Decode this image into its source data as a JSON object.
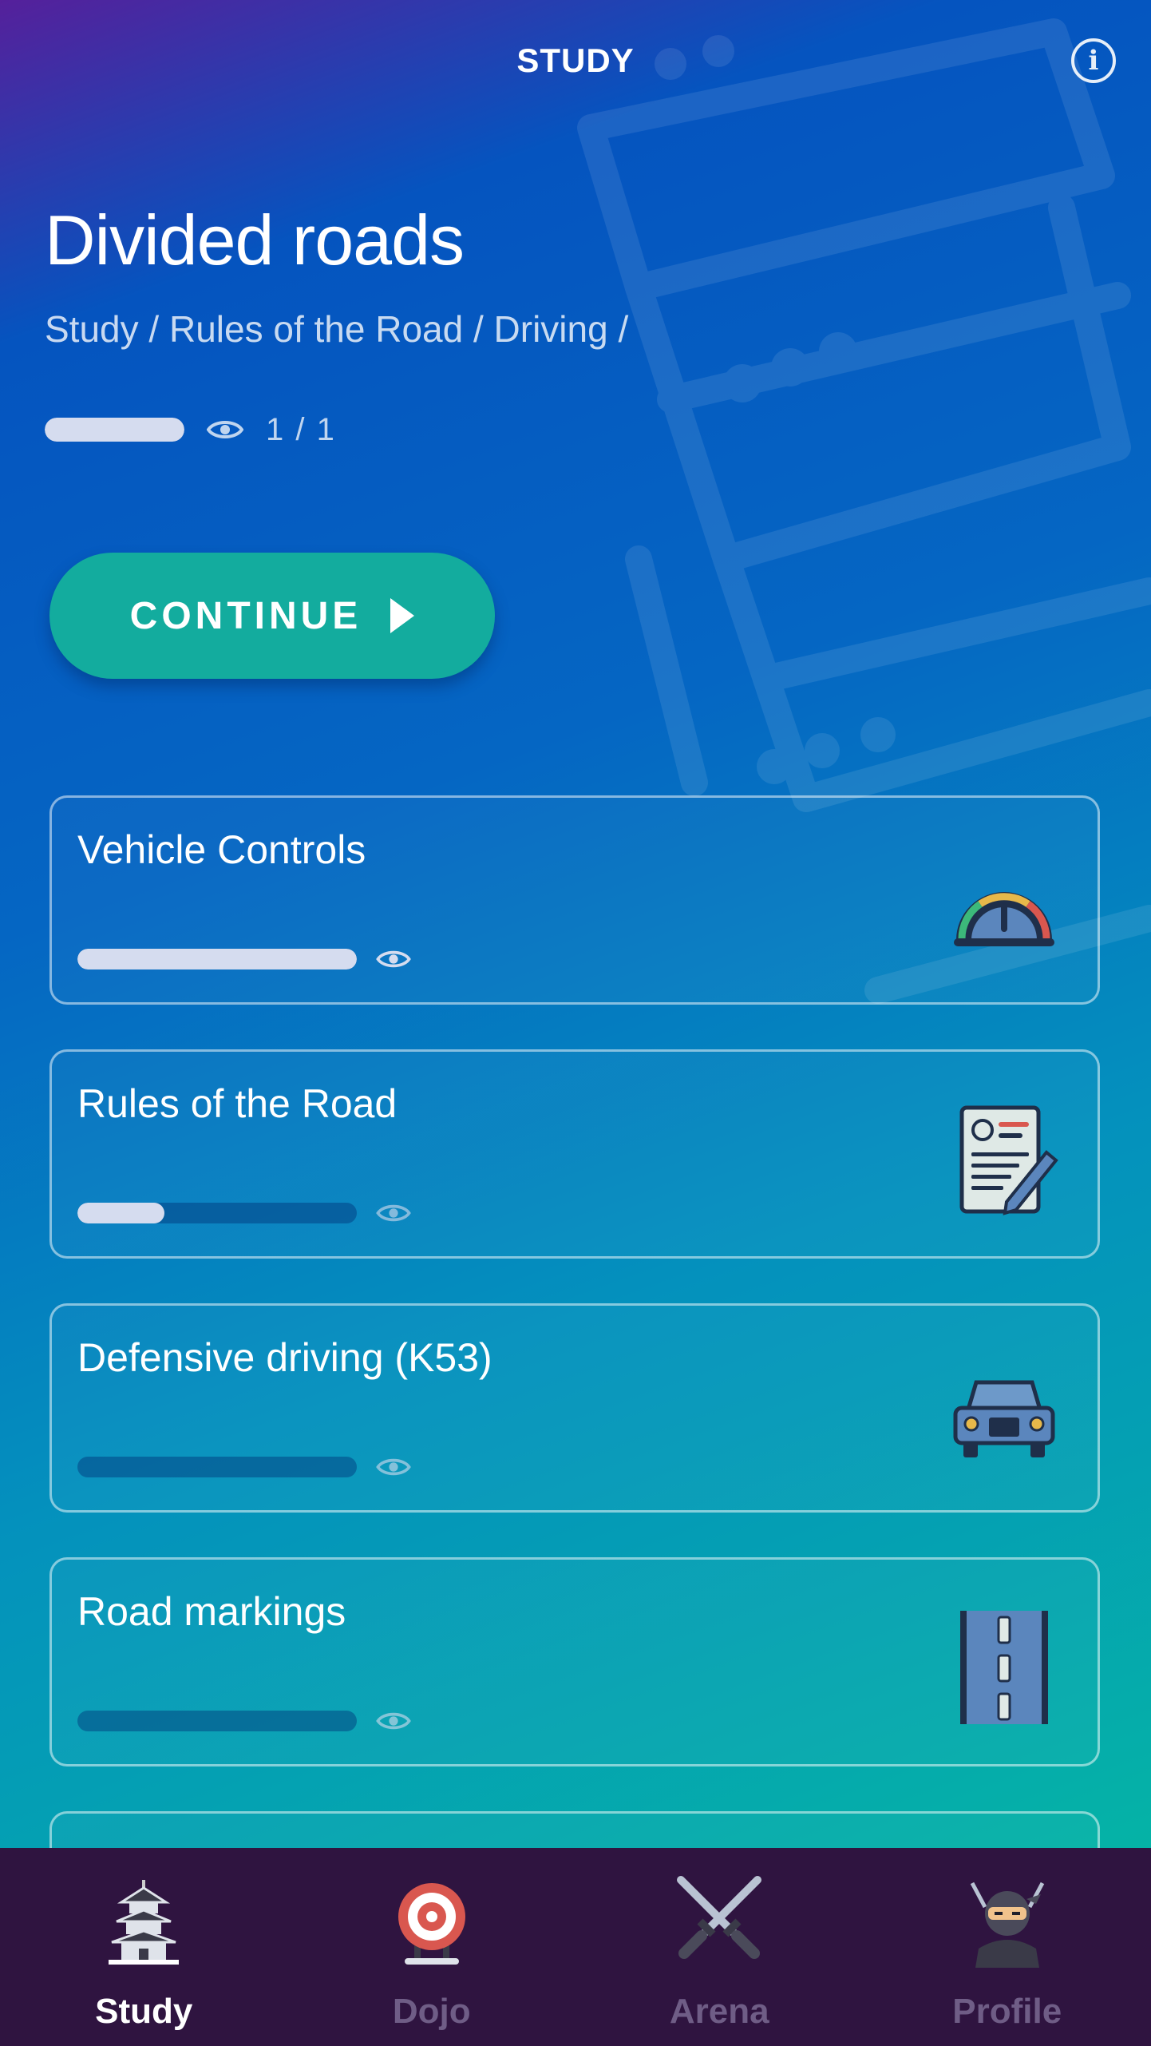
{
  "header": {
    "title": "STUDY",
    "info_icon": "info-icon"
  },
  "topic": {
    "title": "Divided roads",
    "breadcrumb": "Study / Rules of the Road / Driving /",
    "progress": 1.0,
    "progress_count": "1 / 1"
  },
  "continue_button": {
    "label": "CONTINUE",
    "icon": "play-icon"
  },
  "cards": [
    {
      "title": "Vehicle Controls",
      "progress": 1.0,
      "icon": "speedometer-icon"
    },
    {
      "title": "Rules of the Road",
      "progress": 0.31,
      "icon": "license-document-icon"
    },
    {
      "title": "Defensive driving (K53)",
      "progress": 0.0,
      "icon": "car-icon"
    },
    {
      "title": "Road markings",
      "progress": 0.0,
      "icon": "road-icon"
    }
  ],
  "bottom_nav": [
    {
      "label": "Study",
      "icon": "pagoda-icon",
      "active": true
    },
    {
      "label": "Dojo",
      "icon": "target-icon",
      "active": false
    },
    {
      "label": "Arena",
      "icon": "crossed-swords-icon",
      "active": false
    },
    {
      "label": "Profile",
      "icon": "ninja-icon",
      "active": false
    }
  ],
  "colors": {
    "gradient_top": "#55209b",
    "gradient_mid": "#0566c3",
    "gradient_bottom": "#05b3a6",
    "continue_button": "#13ac9e",
    "nav_background": "#2f1440",
    "progress_fill": "#d5dcef",
    "nav_inactive": "#6f5d86"
  }
}
